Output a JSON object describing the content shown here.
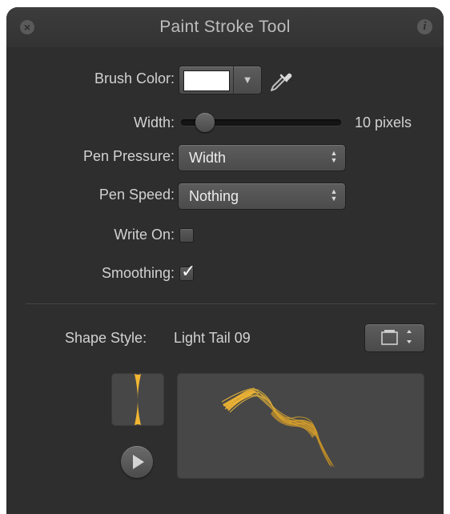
{
  "window": {
    "title": "Paint Stroke Tool",
    "close_icon": "close-icon",
    "info_icon": "info-icon",
    "close_glyph": "×",
    "info_glyph": "i"
  },
  "brush_color": {
    "label": "Brush Color:",
    "color": "#FFFFFF",
    "dropdown_glyph": "▼",
    "eyedropper_icon": "eyedropper-icon"
  },
  "width": {
    "label": "Width:",
    "value_text": "10 pixels",
    "slider_fraction": 0.1
  },
  "pen_pressure": {
    "label": "Pen Pressure:",
    "selected": "Width"
  },
  "pen_speed": {
    "label": "Pen Speed:",
    "selected": "Nothing"
  },
  "write_on": {
    "label": "Write On:",
    "checked": false
  },
  "smoothing": {
    "label": "Smoothing:",
    "checked": true,
    "check_glyph": "✓"
  },
  "shape_style": {
    "label": "Shape Style:",
    "value": "Light Tail 09",
    "library_icon": "shape-library-icon",
    "play_icon": "play-icon",
    "stroke_color": "#F2B632"
  },
  "colors": {
    "panel_bg": "#2E2E2E",
    "text": "#D2D2D2",
    "accent_stroke": "#F2B632"
  }
}
